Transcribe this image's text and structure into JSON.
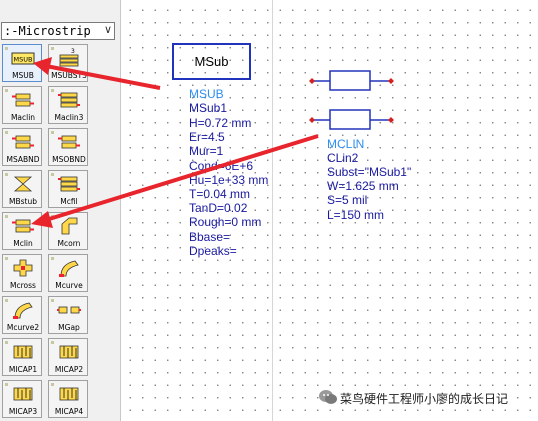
{
  "palette": {
    "library": "Microstrip",
    "library_display": ":-Microstrip",
    "chevron": "∨",
    "items": [
      {
        "label": "MSUB",
        "icon": "msub-icon",
        "selected": true
      },
      {
        "label": "MSUBST3",
        "icon": "msubst3-icon",
        "selected": false
      },
      {
        "label": "Maclin",
        "icon": "maclin-icon",
        "selected": false
      },
      {
        "label": "Maclin3",
        "icon": "maclin3-icon",
        "selected": false
      },
      {
        "label": "MSABND",
        "icon": "msabnd-icon",
        "selected": false
      },
      {
        "label": "MSOBND",
        "icon": "msobnd-icon",
        "selected": false
      },
      {
        "label": "MBstub",
        "icon": "mbstub-icon",
        "selected": false
      },
      {
        "label": "Mcfil",
        "icon": "mcfil-icon",
        "selected": false
      },
      {
        "label": "Mclin",
        "icon": "mclin-icon",
        "selected": false
      },
      {
        "label": "Mcorn",
        "icon": "mcorn-icon",
        "selected": false
      },
      {
        "label": "Mcross",
        "icon": "mcross-icon",
        "selected": false
      },
      {
        "label": "Mcurve",
        "icon": "mcurve-icon",
        "selected": false
      },
      {
        "label": "Mcurve2",
        "icon": "mcurve2-icon",
        "selected": false
      },
      {
        "label": "MGap",
        "icon": "mgap-icon",
        "selected": false
      },
      {
        "label": "MICAP1",
        "icon": "micap1-icon",
        "selected": false
      },
      {
        "label": "MICAP2",
        "icon": "micap2-icon",
        "selected": false
      },
      {
        "label": "MICAP3",
        "icon": "micap3-icon",
        "selected": false
      },
      {
        "label": "MICAP4",
        "icon": "micap4-icon",
        "selected": false
      }
    ]
  },
  "msub": {
    "symbol_label": "MSub",
    "type": "MSUB",
    "name": "MSub1",
    "params": [
      "H=0.72 mm",
      "Er=4.5",
      "Mur=1",
      "Cond=6E+6",
      "Hu=1e+33 mm",
      "T=0.04 mm",
      "TanD=0.02",
      "Rough=0 mm",
      "Bbase=",
      "Dpeaks="
    ]
  },
  "mclin": {
    "type": "MCLIN",
    "name": "CLin2",
    "params": [
      "Subst=\"MSub1\"",
      "W=1.625 mm",
      "S=5 mil",
      "L=150 mm"
    ]
  },
  "watermark": {
    "icon": "wechat-icon",
    "text": "菜鸟硬件工程师小廖的成长日记"
  },
  "colors": {
    "arrow": "#e8242c",
    "symbol_stroke": "#2233bb",
    "param_text": "#1a1aa0",
    "type_text": "#2d8ff0",
    "pin": "#d42020"
  }
}
